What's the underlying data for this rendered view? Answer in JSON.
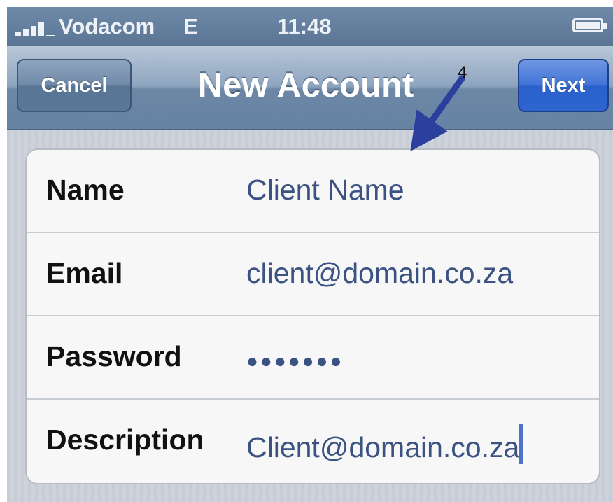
{
  "status_bar": {
    "carrier": "Vodacom",
    "network": "E",
    "time": "11:48",
    "signal_bars": 4,
    "battery_icon": "battery-icon"
  },
  "nav": {
    "title": "New Account",
    "cancel_label": "Cancel",
    "next_label": "Next"
  },
  "annotation": {
    "number": "4",
    "color": "#2b3f9c"
  },
  "form": {
    "rows": [
      {
        "label": "Name",
        "value": "Client Name"
      },
      {
        "label": "Email",
        "value": "client@domain.co.za"
      },
      {
        "label": "Password",
        "value": "●●●●●●●"
      },
      {
        "label": "Description",
        "value": "Client@domain.co.za"
      }
    ]
  },
  "colors": {
    "nav_bar": "#6d87a6",
    "next_button": "#2b61cc",
    "value_text": "#3b5283",
    "cursor": "#4f73c9"
  }
}
